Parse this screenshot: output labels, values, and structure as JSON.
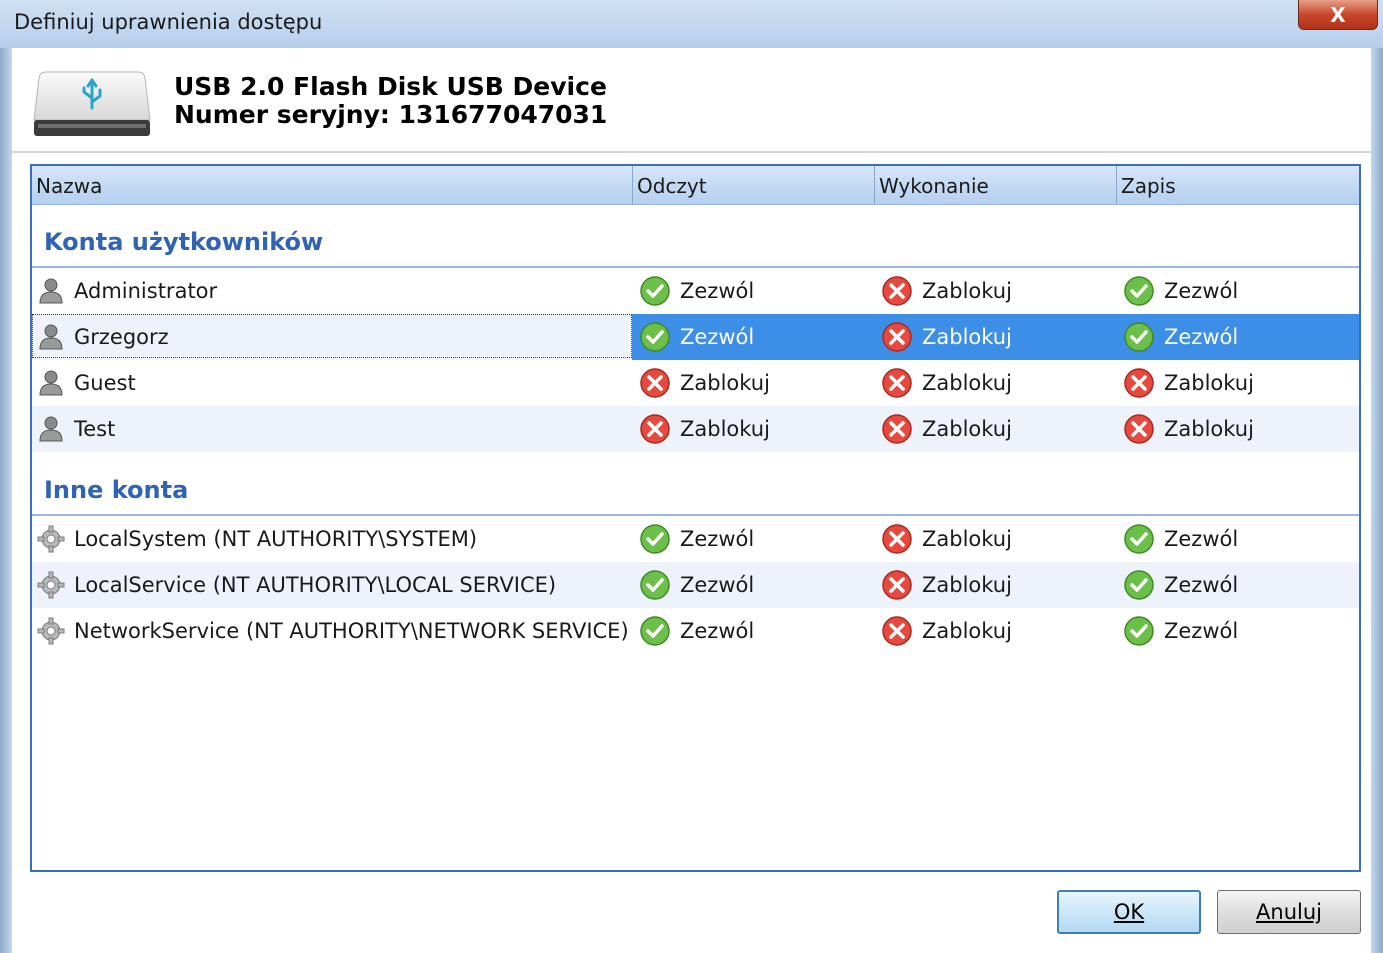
{
  "window": {
    "title": "Definiuj uprawnienia dostępu",
    "close_label": "X"
  },
  "device": {
    "name": "USB 2.0 Flash Disk USB Device",
    "serial": "Numer seryjny: 131677047031"
  },
  "columns": {
    "name": "Nazwa",
    "read": "Odczyt",
    "execute": "Wykonanie",
    "write": "Zapis"
  },
  "groups": [
    {
      "title": "Konta użytkowników",
      "icon": "user-icon",
      "rows": [
        {
          "name": "Administrator",
          "read": "Zezwól",
          "execute": "Zablokuj",
          "write": "Zezwól"
        },
        {
          "name": "Grzegorz",
          "read": "Zezwól",
          "execute": "Zablokuj",
          "write": "Zezwól"
        },
        {
          "name": "Guest",
          "read": "Zablokuj",
          "execute": "Zablokuj",
          "write": "Zablokuj"
        },
        {
          "name": "Test",
          "read": "Zablokuj",
          "execute": "Zablokuj",
          "write": "Zablokuj"
        }
      ]
    },
    {
      "title": "Inne konta",
      "icon": "gear-icon",
      "rows": [
        {
          "name": "LocalSystem (NT AUTHORITY\\SYSTEM)",
          "read": "Zezwól",
          "execute": "Zablokuj",
          "write": "Zezwól"
        },
        {
          "name": "LocalService (NT AUTHORITY\\LOCAL SERVICE)",
          "read": "Zezwól",
          "execute": "Zablokuj",
          "write": "Zezwól"
        },
        {
          "name": "NetworkService (NT AUTHORITY\\NETWORK SERVICE)",
          "read": "Zezwól",
          "execute": "Zablokuj",
          "write": "Zezwól"
        }
      ]
    }
  ],
  "selected_row": "Grzegorz",
  "buttons": {
    "ok": "OK",
    "cancel": "Anuluj"
  },
  "colors": {
    "accent": "#2f63b5",
    "selection": "#3d8ee6",
    "allow": "#5cb33a",
    "deny": "#e0443a"
  }
}
